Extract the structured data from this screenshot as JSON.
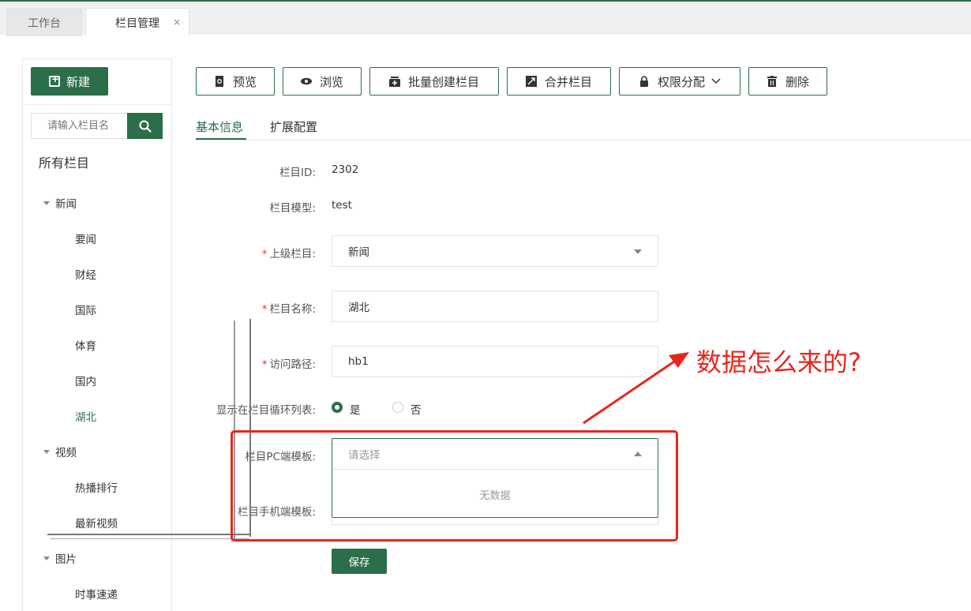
{
  "tabs": [
    {
      "label": "工作台"
    },
    {
      "label": "栏目管理",
      "close": "×"
    }
  ],
  "sidebar": {
    "new_label": "新建",
    "search_placeholder": "请输入栏目名",
    "all_title": "所有栏目",
    "tree": [
      {
        "label": "新闻",
        "level": 0
      },
      {
        "label": "要闻",
        "level": 1
      },
      {
        "label": "财经",
        "level": 1
      },
      {
        "label": "国际",
        "level": 1
      },
      {
        "label": "体育",
        "level": 1
      },
      {
        "label": "国内",
        "level": 1
      },
      {
        "label": "湖北",
        "level": 1,
        "active": true
      },
      {
        "label": "视频",
        "level": 0
      },
      {
        "label": "热播排行",
        "level": 1
      },
      {
        "label": "最新视频",
        "level": 1
      },
      {
        "label": "图片",
        "level": 0
      },
      {
        "label": "时事速递",
        "level": 1
      }
    ]
  },
  "toolbar": {
    "preview": "预览",
    "browse": "浏览",
    "batch_create": "批量创建栏目",
    "merge": "合并栏目",
    "permissions": "权限分配",
    "delete": "删除"
  },
  "subtabs": {
    "basic": "基本信息",
    "extended": "扩展配置"
  },
  "form": {
    "id_label": "栏目ID:",
    "id_value": "2302",
    "model_label": "栏目模型:",
    "model_value": "test",
    "parent_label": "上级栏目:",
    "parent_value": "新闻",
    "name_label": "栏目名称:",
    "name_value": "湖北",
    "path_label": "访问路径:",
    "path_value": "hb1",
    "show_label": "显示在栏目循环列表:",
    "show_yes": "是",
    "show_no": "否",
    "pc_template_label": "栏目PC端模板:",
    "pc_template_placeholder": "请选择",
    "no_data": "无数据",
    "mobile_template_label": "栏目手机端模板:",
    "save": "保存"
  },
  "annotation": {
    "text": "数据怎么来的?"
  },
  "colors": {
    "accent": "#2b6e4a",
    "annotation": "#e8261d"
  }
}
